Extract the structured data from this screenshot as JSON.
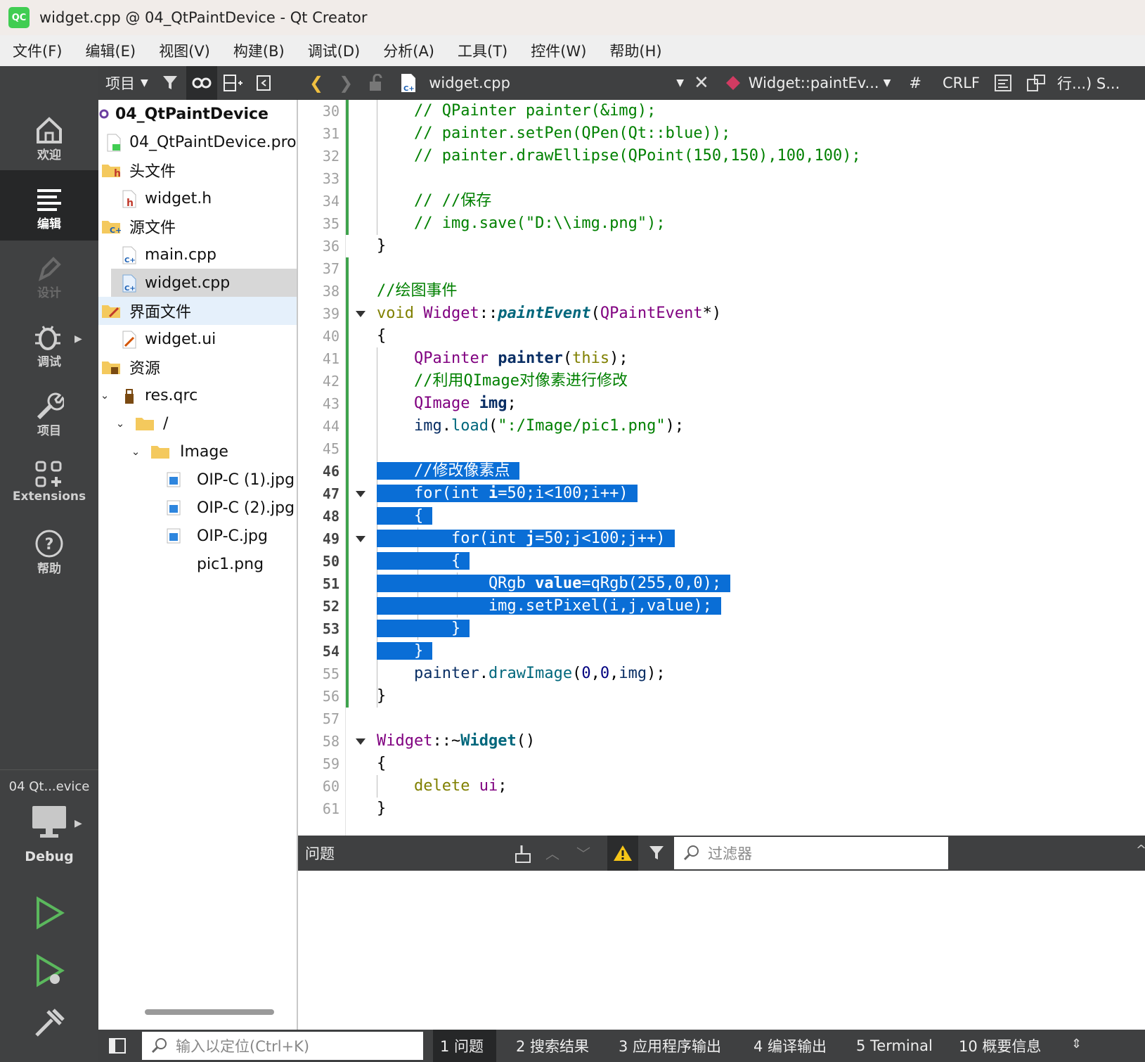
{
  "window": {
    "title": "widget.cpp @ 04_QtPaintDevice - Qt Creator",
    "logo": "QC"
  },
  "menu": [
    "文件(F)",
    "编辑(E)",
    "视图(V)",
    "构建(B)",
    "调试(D)",
    "分析(A)",
    "工具(T)",
    "控件(W)",
    "帮助(H)"
  ],
  "modes": [
    {
      "label": "欢迎",
      "icon": "home-icon"
    },
    {
      "label": "编辑",
      "icon": "edit-lines-icon"
    },
    {
      "label": "设计",
      "icon": "pen-icon"
    },
    {
      "label": "调试",
      "icon": "bug-icon"
    },
    {
      "label": "项目",
      "icon": "wrench-icon"
    },
    {
      "label": "Extensions",
      "icon": "extensions-icon"
    },
    {
      "label": "帮助",
      "icon": "help-icon"
    }
  ],
  "kit": {
    "project": "04 Qt...evice",
    "config": "Debug"
  },
  "project_toolbar": {
    "label": "项目"
  },
  "tree": [
    {
      "label": "04_QtPaintDevice",
      "bold": true
    },
    {
      "label": "04_QtPaintDevice.pro"
    },
    {
      "label": "头文件"
    },
    {
      "label": "widget.h"
    },
    {
      "label": "源文件"
    },
    {
      "label": "main.cpp"
    },
    {
      "label": "widget.cpp"
    },
    {
      "label": "界面文件"
    },
    {
      "label": "widget.ui"
    },
    {
      "label": "资源"
    },
    {
      "label": "res.qrc"
    },
    {
      "label": "/"
    },
    {
      "label": "Image"
    },
    {
      "label": "OIP-C (1).jpg"
    },
    {
      "label": "OIP-C (2).jpg"
    },
    {
      "label": "OIP-C.jpg"
    },
    {
      "label": "pic1.png"
    }
  ],
  "editor_toolbar": {
    "file": "widget.cpp",
    "symbol": "Widget::paintEv...",
    "hash": "#",
    "line_ending": "CRLF",
    "position": "行...) S..."
  },
  "line_numbers": [
    "30",
    "31",
    "32",
    "33",
    "34",
    "35",
    "36",
    "37",
    "38",
    "39",
    "40",
    "41",
    "42",
    "43",
    "44",
    "45",
    "46",
    "47",
    "48",
    "49",
    "50",
    "51",
    "52",
    "53",
    "54",
    "55",
    "56",
    "57",
    "58",
    "59",
    "60",
    "61"
  ],
  "issues": {
    "title": "问题",
    "filter_placeholder": "过滤器"
  },
  "statusbar": {
    "locator_placeholder": "输入以定位(Ctrl+K)",
    "panes": [
      "1  问题",
      "2  搜索结果",
      "3  应用程序输出",
      "4  编译输出",
      "5  Terminal",
      "10  概要信息"
    ]
  },
  "colors": {
    "accent": "#0a6ed6",
    "sidebar": "#404142",
    "toolbar": "#3f4041",
    "gutter_change": "#3fa34d"
  }
}
